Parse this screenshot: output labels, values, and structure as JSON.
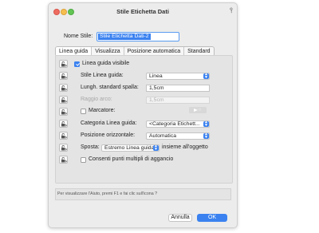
{
  "window": {
    "title": "Stile Etichetta Dati",
    "pin_glyph": "⫯"
  },
  "name_field": {
    "label": "Nome Stile:",
    "value": "Stile Etichetta Dati-2"
  },
  "tabs": [
    "Linea guida",
    "Visualizza",
    "Posizione automatica",
    "Standard"
  ],
  "active_tab": "Linea guida",
  "panel": {
    "visible_label": "Linea guida visibile",
    "visible_checked": true,
    "style_label": "Stile Linea guida:",
    "style_value": "Linea",
    "length_label": "Lungh. standard spalla:",
    "length_value": "1,5cm",
    "radius_label": "Raggio arco:",
    "radius_value": "1,5cm",
    "marker_label": "Marcatore:",
    "marker_checked": false,
    "category_label": "Categoria Linea guida:",
    "category_value": "<Categoria Etichett...",
    "halign_label": "Posizione orizzontale:",
    "halign_value": "Automatica",
    "move_label": "Sposta:",
    "move_value": "Estremo Linea guida",
    "move_suffix": "insieme all'oggetto",
    "multi_label": "Consenti punti multipli di aggancio",
    "multi_checked": false
  },
  "help_text": "Per visualizzare l'Aiuto, premi F1 e fai clic sull'icona ?",
  "buttons": {
    "cancel": "Annulla",
    "ok": "OK"
  },
  "colors": {
    "accent": "#3b82f0"
  },
  "icons": {
    "lock": "lock-icon"
  }
}
